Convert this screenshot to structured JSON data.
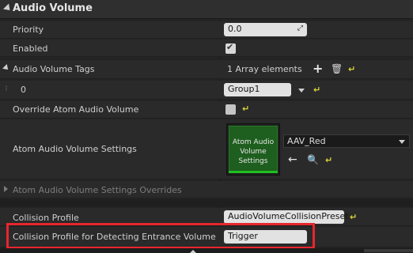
{
  "header": {
    "title": "Audio Volume"
  },
  "rows": {
    "priority": {
      "label": "Priority",
      "value": "0.0"
    },
    "enabled": {
      "label": "Enabled"
    },
    "tags": {
      "label": "Audio Volume Tags",
      "count": "1 Array elements"
    },
    "tag0": {
      "index": "0",
      "value": "Group1"
    },
    "override": {
      "label": "Override Atom Audio Volume"
    },
    "settings": {
      "label": "Atom Audio Volume Settings",
      "thumb_text": "Atom Audio Volume Settings",
      "asset": "AAV_Red"
    },
    "settings_overrides": {
      "label": "Atom Audio Volume Settings Overrides"
    },
    "collision": {
      "label": "Collision Profile",
      "value": "AudioVolumeCollisionPreset"
    },
    "entrance": {
      "label": "Collision Profile for Detecting Entrance Volume",
      "value": "Trigger"
    }
  },
  "icons": {
    "reset": "reset-arrow-icon",
    "add": "plus-icon",
    "delete": "trash-icon",
    "browse": "arrow-left-icon",
    "find": "magnifier-icon"
  },
  "colors": {
    "highlight": "#e8262e",
    "reset": "#d7d23a",
    "thumb_green": "#1e5e1e"
  }
}
